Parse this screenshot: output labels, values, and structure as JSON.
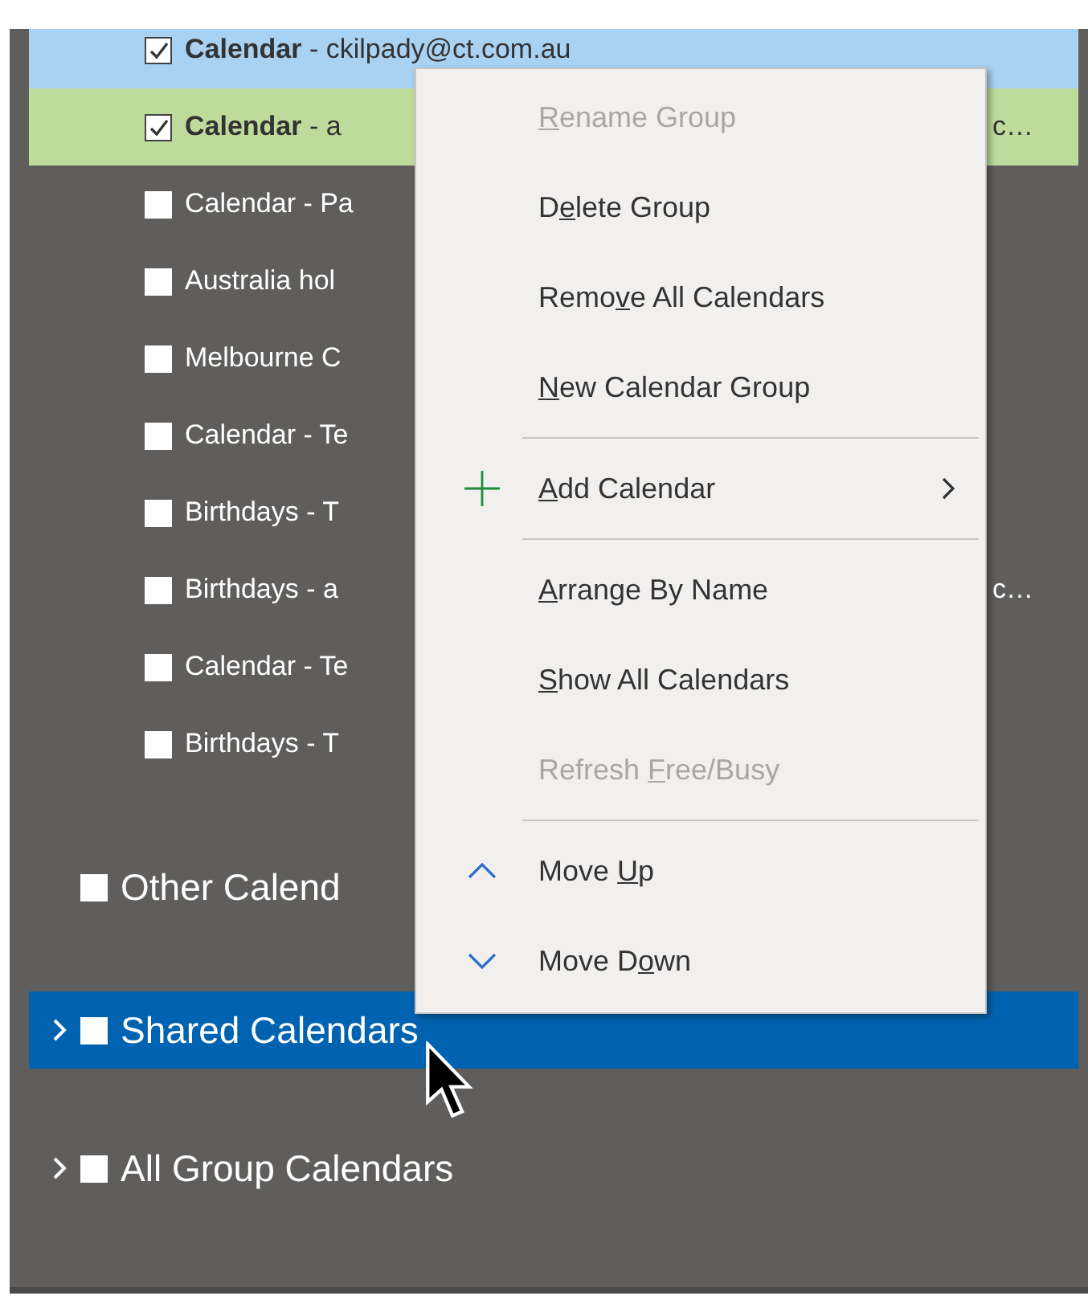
{
  "calendars": [
    {
      "label": "**Calendar** - ckilpady@ct.com.au",
      "checked": true,
      "color": "#a8d1f2"
    },
    {
      "label": "**Calendar** - a",
      "tail": "c…",
      "checked": true,
      "color": "#bedb9b"
    },
    {
      "label": "Calendar - Pa",
      "checked": false
    },
    {
      "label": "Australia hol",
      "checked": false
    },
    {
      "label": "Melbourne C",
      "checked": false
    },
    {
      "label": "Calendar - Te",
      "checked": false
    },
    {
      "label": "Birthdays - T",
      "checked": false
    },
    {
      "label": "Birthdays - a",
      "tail": "c…",
      "checked": false
    },
    {
      "label": "Calendar - Te",
      "checked": false
    },
    {
      "label": "Birthdays - T",
      "checked": false
    }
  ],
  "groups": [
    {
      "label": "Other Calend",
      "checked": false,
      "expandable": false,
      "selected": false
    },
    {
      "label": "Shared Calendars",
      "checked": false,
      "expandable": true,
      "selected": true
    },
    {
      "label": "All Group Calendars",
      "checked": false,
      "expandable": true,
      "selected": false
    }
  ],
  "context_menu": {
    "items": [
      {
        "kind": "item",
        "key": "R",
        "after": "ename Group",
        "disabled": true
      },
      {
        "kind": "item",
        "before": "D",
        "key": "e",
        "after": "lete Group",
        "disabled": false
      },
      {
        "kind": "item",
        "before": "Remo",
        "key": "v",
        "after": "e All Calendars",
        "disabled": false
      },
      {
        "kind": "item",
        "key": "N",
        "after": "ew Calendar Group",
        "disabled": false
      },
      {
        "kind": "separator"
      },
      {
        "kind": "add",
        "key": "A",
        "after": "dd Calendar",
        "disabled": false
      },
      {
        "kind": "separator"
      },
      {
        "kind": "item",
        "key": "A",
        "after": "rrange By Name",
        "disabled": false
      },
      {
        "kind": "item",
        "key": "S",
        "after": "how All Calendars",
        "disabled": false
      },
      {
        "kind": "item",
        "before": "Refresh ",
        "key": "F",
        "after": "ree/Busy",
        "disabled": true
      },
      {
        "kind": "separator"
      },
      {
        "kind": "up",
        "before": "Move ",
        "key": "U",
        "after": "p",
        "disabled": false
      },
      {
        "kind": "down",
        "before": "Move D",
        "key": "o",
        "after": "wn",
        "disabled": false
      }
    ]
  }
}
